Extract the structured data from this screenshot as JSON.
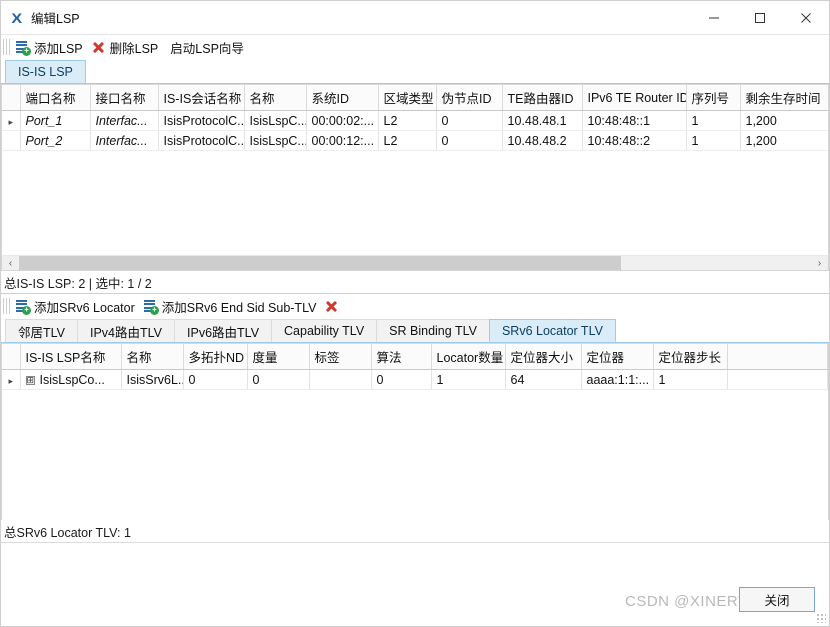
{
  "window": {
    "title": "编辑LSP",
    "app_icon": "x-logo-icon",
    "controls": {
      "minimize": "minimize-icon",
      "maximize": "maximize-icon",
      "close": "close-icon"
    }
  },
  "lsp_panel": {
    "toolbar": [
      {
        "icon": "add-list-icon",
        "label": "添加LSP"
      },
      {
        "icon": "delete-x-icon",
        "label": "删除LSP"
      },
      {
        "icon": "none",
        "label": "启动LSP向导"
      }
    ],
    "tabs": [
      {
        "label": "IS-IS LSP",
        "active": true
      }
    ],
    "columns": [
      "端口名称",
      "接口名称",
      "IS-IS会话名称",
      "名称",
      "系统ID",
      "区域类型",
      "伪节点ID",
      "TE路由器ID",
      "IPv6 TE Router ID",
      "序列号",
      "剩余生存时间"
    ],
    "rows": [
      {
        "selected": true,
        "cells": [
          "Port_1",
          "Interfac...",
          "IsisProtocolC...",
          "IsisLspC...",
          "00:00:02:...",
          "L2",
          "0",
          "10.48.48.1",
          "10:48:48::1",
          "1",
          "1,200"
        ]
      },
      {
        "selected": false,
        "cells": [
          "Port_2",
          "Interfac...",
          "IsisProtocolC...",
          "IsisLspC...",
          "00:00:12:...",
          "L2",
          "0",
          "10.48.48.2",
          "10:48:48::2",
          "1",
          "1,200"
        ]
      }
    ],
    "scrollbar": {
      "left_arrow": "‹",
      "right_arrow": "›",
      "thumb_width_pct": "76%"
    },
    "status": "总IS-IS LSP: 2 | 选中: 1 / 2"
  },
  "tlv_panel": {
    "toolbar": [
      {
        "icon": "add-list-icon",
        "label": "添加SRv6 Locator"
      },
      {
        "icon": "add-list-icon",
        "label": "添加SRv6 End Sid Sub-TLV"
      },
      {
        "icon": "delete-x-icon",
        "label": ""
      }
    ],
    "tabs": [
      {
        "label": "邻居TLV",
        "active": false
      },
      {
        "label": "IPv4路由TLV",
        "active": false
      },
      {
        "label": "IPv6路由TLV",
        "active": false
      },
      {
        "label": "Capability TLV",
        "active": false
      },
      {
        "label": "SR Binding TLV",
        "active": false
      },
      {
        "label": "SRv6 Locator TLV",
        "active": true
      }
    ],
    "columns": [
      "IS-IS LSP名称",
      "名称",
      "多拓扑ND",
      "度量",
      "标签",
      "算法",
      "Locator数量",
      "定位器大小",
      "定位器",
      "定位器步长",
      ""
    ],
    "rows": [
      {
        "selected": true,
        "expander": "⊞",
        "cells": [
          "IsisLspCo...",
          "IsisSrv6L...",
          "0",
          "0",
          "",
          "0",
          "1",
          "64",
          "aaaa:1:1:...",
          "1",
          ""
        ]
      }
    ],
    "status": "总SRv6 Locator TLV: 1"
  },
  "footer": {
    "close_button": "关闭",
    "watermark": "CSDN @XINERTEL"
  }
}
